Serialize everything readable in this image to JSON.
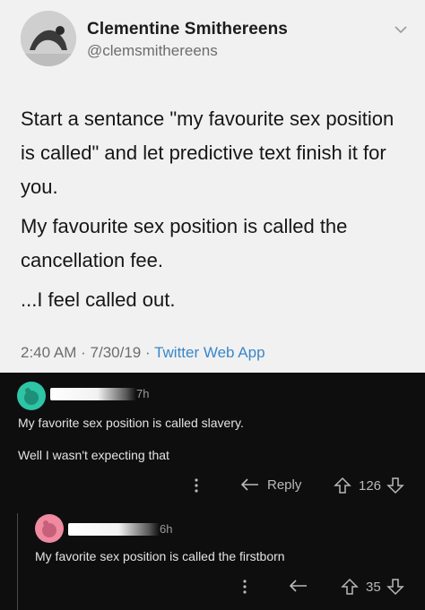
{
  "tweet": {
    "display_name": "Clementine Smithereens",
    "handle": "@clemsmithereens",
    "body": [
      "Start a sentance \"my favourite sex position is called\" and let predictive text finish it for you.",
      "My favourite sex position is called the cancellation fee.",
      "...I feel called out."
    ],
    "time": "2:40 AM",
    "date": "7/30/19",
    "separator": "·",
    "client": "Twitter Web App"
  },
  "comments": [
    {
      "time": "7h",
      "text": "My favorite sex position is called slavery.",
      "text2": "Well I wasn't expecting that",
      "reply_label": "Reply",
      "score": "126",
      "avatar_color": "#2ec4a6"
    },
    {
      "time": "6h",
      "text": "My favorite sex position is called the firstborn",
      "score": "35",
      "avatar_color": "#f08aa0"
    }
  ],
  "icons": [
    "chevron-down-icon",
    "more-icon",
    "reply-icon",
    "upvote-icon",
    "downvote-icon"
  ]
}
